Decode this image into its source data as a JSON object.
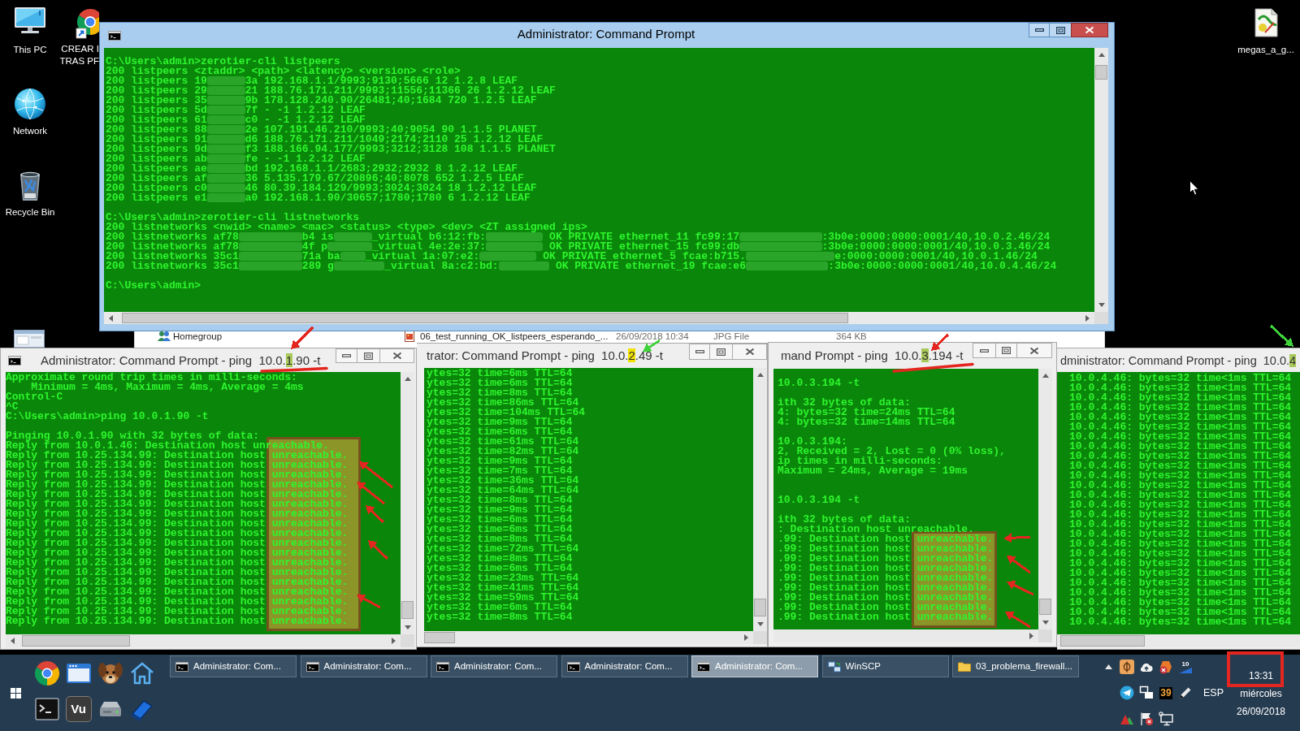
{
  "desktop_icons": [
    {
      "label": [
        "This PC"
      ]
    },
    {
      "label": [
        "CREAR I",
        "TRAS PF"
      ]
    },
    {
      "label": [
        "Network"
      ]
    },
    {
      "label": [
        "Recycle Bin"
      ]
    },
    {
      "label": [
        "megas_a_g..."
      ]
    }
  ],
  "main_console": {
    "title": "Administrator: Command Prompt",
    "active": true,
    "lines": [
      {
        "kind": "text",
        "parts": [
          "C:\\Users\\admin>zerotier-cli listpeers"
        ]
      },
      {
        "kind": "text",
        "parts": [
          "200 listpeers <ztaddr> <path> <latency> <version> <role>"
        ]
      },
      {
        "kind": "text",
        "parts": [
          "200 listpeers 19",
          "3a 192.168.1.1/9993;9130;5666 12 1.2.8 LEAF"
        ]
      },
      {
        "kind": "text",
        "parts": [
          "200 listpeers 29",
          "21 188.76.171.211/9993;11556;11366 26 1.2.12 LEAF"
        ]
      },
      {
        "kind": "text",
        "parts": [
          "200 listpeers 35",
          "9b 178.128.240.90/26481;40;1684 720 1.2.5 LEAF"
        ]
      },
      {
        "kind": "text",
        "parts": [
          "200 listpeers 5d",
          "7f - -1 1.2.12 LEAF"
        ]
      },
      {
        "kind": "text",
        "parts": [
          "200 listpeers 61",
          "c0 - -1 1.2.12 LEAF"
        ]
      },
      {
        "kind": "text",
        "parts": [
          "200 listpeers 88",
          "2e 107.191.46.210/9993;40;9054 90 1.1.5 PLANET"
        ]
      },
      {
        "kind": "text",
        "parts": [
          "200 listpeers 91",
          "d6 188.76.171.211/1049;2174;2110 25 1.2.12 LEAF"
        ]
      },
      {
        "kind": "text",
        "parts": [
          "200 listpeers 9d",
          "f3 188.166.94.177/9993;3212;3128 108 1.1.5 PLANET"
        ]
      },
      {
        "kind": "text",
        "parts": [
          "200 listpeers ab",
          "fe - -1 1.2.12 LEAF"
        ]
      },
      {
        "kind": "text",
        "parts": [
          "200 listpeers ae",
          "bd 192.168.1.1/2683;2932;2932 8 1.2.12 LEAF"
        ]
      },
      {
        "kind": "text",
        "parts": [
          "200 listpeers af",
          "36 5.135.179.67/20896;40;8078 652 1.2.5 LEAF"
        ]
      },
      {
        "kind": "text",
        "parts": [
          "200 listpeers c0",
          "46 80.39.184.129/9993;3024;3024 18 1.2.12 LEAF"
        ]
      },
      {
        "kind": "text",
        "parts": [
          "200 listpeers e1",
          "a0 192.168.1.90/30657;1780;1780 6 1.2.12 LEAF"
        ]
      },
      {
        "kind": "blank"
      },
      {
        "kind": "text",
        "parts": [
          "C:\\Users\\admin>zerotier-cli listnetworks"
        ]
      },
      {
        "kind": "text",
        "parts": [
          "200 listnetworks <nwid> <name> <mac> <status> <type> <dev> <ZT assigned ips>"
        ]
      },
      {
        "kind": "text",
        "parts": [
          "200 listnetworks af78",
          "b4 is",
          "_virtual b6:12:fb:",
          " OK PRIVATE ethernet_11 fc99:17",
          ":3b0e:0000:0000:0001/40,10.0.2.46/24"
        ]
      },
      {
        "kind": "text",
        "parts": [
          "200 listnetworks af78",
          "4f p",
          "_virtual 4e:2e:37:",
          " OK PRIVATE ethernet_15 fc99:db",
          ":3b0e:0000:0000:0001/40,10.0.3.46/24"
        ]
      },
      {
        "kind": "text",
        "parts": [
          "200 listnetworks 35c1",
          "71a ba",
          "_virtual 1a:07:e2:",
          " OK PRIVATE ethernet_5 fcae:b715.",
          "e:0000:0000:0001/40,10.0.1.46/24"
        ]
      },
      {
        "kind": "text",
        "parts": [
          "200 listnetworks 35c1",
          "289 g",
          "_virtual 8a:c2:bd:",
          " OK PRIVATE ethernet_19 fcae:e6",
          ":3b0e:0000:0000:0001/40,10.0.4.46/24"
        ]
      },
      {
        "kind": "blank"
      },
      {
        "kind": "text",
        "parts": [
          "C:\\Users\\admin>"
        ]
      }
    ]
  },
  "explorer_window": {
    "nav_item": "Homegroup",
    "file": {
      "name": "06_test_running_OK_listpeers_esperando_...",
      "date_modified": "26/09/2018 10:34",
      "type": "JPG File",
      "size": "364 KB"
    }
  },
  "ping_windows": [
    {
      "active": false,
      "title": [
        {
          "text": "Administrator: Command Prompt - ping  10.0.",
          "highlighted": false
        },
        {
          "text": "1",
          "highlighted": true,
          "color": "#a9c95a"
        },
        {
          "text": ".90 -t",
          "highlighted": false
        }
      ],
      "lines": [
        {
          "kind": "text",
          "text": "Approximate round trip times in milli-seconds:"
        },
        {
          "kind": "text",
          "text": "    Minimum = 4ms, Maximum = 4ms, Average = 4ms"
        },
        {
          "kind": "text",
          "text": "Control-C"
        },
        {
          "kind": "text",
          "text": "^C"
        },
        {
          "kind": "text",
          "text": "C:\\Users\\admin>ping 10.0.1.90 -t"
        },
        {
          "kind": "blank"
        },
        {
          "kind": "text",
          "text": "Pinging 10.0.1.90 with 32 bytes of data:"
        },
        {
          "kind": "text",
          "text": "Reply from 10.0.1.46: Destination host unreachable."
        },
        {
          "kind": "text",
          "text": "Reply from 10.25.134.99: Destination host unreachable."
        },
        {
          "kind": "text",
          "text": "Reply from 10.25.134.99: Destination host unreachable."
        },
        {
          "kind": "text",
          "text": "Reply from 10.25.134.99: Destination host unreachable."
        },
        {
          "kind": "text",
          "text": "Reply from 10.25.134.99: Destination host unreachable."
        },
        {
          "kind": "text",
          "text": "Reply from 10.25.134.99: Destination host unreachable."
        },
        {
          "kind": "text",
          "text": "Reply from 10.25.134.99: Destination host unreachable."
        },
        {
          "kind": "text",
          "text": "Reply from 10.25.134.99: Destination host unreachable."
        },
        {
          "kind": "text",
          "text": "Reply from 10.25.134.99: Destination host unreachable."
        },
        {
          "kind": "text",
          "text": "Reply from 10.25.134.99: Destination host unreachable."
        },
        {
          "kind": "text",
          "text": "Reply from 10.25.134.99: Destination host unreachable."
        },
        {
          "kind": "text",
          "text": "Reply from 10.25.134.99: Destination host unreachable."
        },
        {
          "kind": "text",
          "text": "Reply from 10.25.134.99: Destination host unreachable."
        },
        {
          "kind": "text",
          "text": "Reply from 10.25.134.99: Destination host unreachable."
        },
        {
          "kind": "text",
          "text": "Reply from 10.25.134.99: Destination host unreachable."
        },
        {
          "kind": "text",
          "text": "Reply from 10.25.134.99: Destination host unreachable."
        },
        {
          "kind": "text",
          "text": "Reply from 10.25.134.99: Destination host unreachable."
        },
        {
          "kind": "text",
          "text": "Reply from 10.25.134.99: Destination host unreachable."
        },
        {
          "kind": "text",
          "text": "Reply from 10.25.134.99: Destination host unreachable."
        }
      ]
    },
    {
      "active": false,
      "title": [
        {
          "text": "trator: Command Prompt - ping  10.0.",
          "highlighted": false
        },
        {
          "text": "2",
          "highlighted": true,
          "color": "#f2e200"
        },
        {
          "text": ".49 -t",
          "highlighted": false
        }
      ],
      "lines": [
        {
          "kind": "text",
          "text": "ytes=32 time=6ms TTL=64"
        },
        {
          "kind": "text",
          "text": "ytes=32 time=6ms TTL=64"
        },
        {
          "kind": "text",
          "text": "ytes=32 time=8ms TTL=64"
        },
        {
          "kind": "text",
          "text": "ytes=32 time=86ms TTL=64"
        },
        {
          "kind": "text",
          "text": "ytes=32 time=104ms TTL=64"
        },
        {
          "kind": "text",
          "text": "ytes=32 time=9ms TTL=64"
        },
        {
          "kind": "text",
          "text": "ytes=32 time=6ms TTL=64"
        },
        {
          "kind": "text",
          "text": "ytes=32 time=61ms TTL=64"
        },
        {
          "kind": "text",
          "text": "ytes=32 time=82ms TTL=64"
        },
        {
          "kind": "text",
          "text": "ytes=32 time=9ms TTL=64"
        },
        {
          "kind": "text",
          "text": "ytes=32 time=7ms TTL=64"
        },
        {
          "kind": "text",
          "text": "ytes=32 time=36ms TTL=64"
        },
        {
          "kind": "text",
          "text": "ytes=32 time=64ms TTL=64"
        },
        {
          "kind": "text",
          "text": "ytes=32 time=8ms TTL=64"
        },
        {
          "kind": "text",
          "text": "ytes=32 time=9ms TTL=64"
        },
        {
          "kind": "text",
          "text": "ytes=32 time=6ms TTL=64"
        },
        {
          "kind": "text",
          "text": "ytes=32 time=6ms TTL=64"
        },
        {
          "kind": "text",
          "text": "ytes=32 time=8ms TTL=64"
        },
        {
          "kind": "text",
          "text": "ytes=32 time=72ms TTL=64"
        },
        {
          "kind": "text",
          "text": "ytes=32 time=8ms TTL=64"
        },
        {
          "kind": "text",
          "text": "ytes=32 time=6ms TTL=64"
        },
        {
          "kind": "text",
          "text": "ytes=32 time=23ms TTL=64"
        },
        {
          "kind": "text",
          "text": "ytes=32 time=41ms TTL=64"
        },
        {
          "kind": "text",
          "text": "ytes=32 time=59ms TTL=64"
        },
        {
          "kind": "text",
          "text": "ytes=32 time=6ms TTL=64"
        },
        {
          "kind": "text",
          "text": "ytes=32 time=8ms TTL=64"
        }
      ]
    },
    {
      "active": false,
      "title": [
        {
          "text": "mand Prompt - ping  10.0.",
          "highlighted": false
        },
        {
          "text": "3",
          "highlighted": true,
          "color": "#a9c95a"
        },
        {
          "text": ".194 -t",
          "highlighted": false
        }
      ],
      "lines": [
        {
          "kind": "blank"
        },
        {
          "kind": "text",
          "text": "10.0.3.194 -t"
        },
        {
          "kind": "blank"
        },
        {
          "kind": "text",
          "text": "ith 32 bytes of data:"
        },
        {
          "kind": "text",
          "text": "4: bytes=32 time=24ms TTL=64"
        },
        {
          "kind": "text",
          "text": "4: bytes=32 time=14ms TTL=64"
        },
        {
          "kind": "blank"
        },
        {
          "kind": "text",
          "text": "10.0.3.194:"
        },
        {
          "kind": "text",
          "text": "2, Received = 2, Lost = 0 (0% loss),"
        },
        {
          "kind": "text",
          "text": "ip times in milli-seconds:"
        },
        {
          "kind": "text",
          "text": "Maximum = 24ms, Average = 19ms"
        },
        {
          "kind": "blank"
        },
        {
          "kind": "blank"
        },
        {
          "kind": "text",
          "text": "10.0.3.194 -t"
        },
        {
          "kind": "blank"
        },
        {
          "kind": "text",
          "text": "ith 32 bytes of data:"
        },
        {
          "kind": "text",
          "text": ": Destination host unreachable."
        },
        {
          "kind": "text",
          "text": ".99: Destination host unreachable."
        },
        {
          "kind": "text",
          "text": ".99: Destination host unreachable."
        },
        {
          "kind": "text",
          "text": ".99: Destination host unreachable."
        },
        {
          "kind": "text",
          "text": ".99: Destination host unreachable."
        },
        {
          "kind": "text",
          "text": ".99: Destination host unreachable."
        },
        {
          "kind": "text",
          "text": ".99: Destination host unreachable."
        },
        {
          "kind": "text",
          "text": ".99: Destination host unreachable."
        },
        {
          "kind": "text",
          "text": ".99: Destination host unreachable."
        },
        {
          "kind": "text",
          "text": ".99: Destination host unreachable."
        }
      ]
    },
    {
      "active": false,
      "title": [
        {
          "text": "dministrator: Command Prompt - ping  10.0.",
          "highlighted": false
        },
        {
          "text": "4",
          "highlighted": true,
          "color": "#a9c95a"
        }
      ],
      "lines": [
        {
          "kind": "text",
          "text": "10.0.4.46: bytes=32 time<1ms TTL=64"
        },
        {
          "kind": "text",
          "text": "10.0.4.46: bytes=32 time<1ms TTL=64"
        },
        {
          "kind": "text",
          "text": "10.0.4.46: bytes=32 time<1ms TTL=64"
        },
        {
          "kind": "text",
          "text": "10.0.4.46: bytes=32 time<1ms TTL=64"
        },
        {
          "kind": "text",
          "text": "10.0.4.46: bytes=32 time<1ms TTL=64"
        },
        {
          "kind": "text",
          "text": "10.0.4.46: bytes=32 time<1ms TTL=64"
        },
        {
          "kind": "text",
          "text": "10.0.4.46: bytes=32 time<1ms TTL=64"
        },
        {
          "kind": "text",
          "text": "10.0.4.46: bytes=32 time<1ms TTL=64"
        },
        {
          "kind": "text",
          "text": "10.0.4.46: bytes=32 time<1ms TTL=64"
        },
        {
          "kind": "text",
          "text": "10.0.4.46: bytes=32 time<1ms TTL=64"
        },
        {
          "kind": "text",
          "text": "10.0.4.46: bytes=32 time<1ms TTL=64"
        },
        {
          "kind": "text",
          "text": "10.0.4.46: bytes=32 time<1ms TTL=64"
        },
        {
          "kind": "text",
          "text": "10.0.4.46: bytes=32 time<1ms TTL=64"
        },
        {
          "kind": "text",
          "text": "10.0.4.46: bytes=32 time<1ms TTL=64"
        },
        {
          "kind": "text",
          "text": "10.0.4.46: bytes=32 time<1ms TTL=64"
        },
        {
          "kind": "text",
          "text": "10.0.4.46: bytes=32 time<1ms TTL=64"
        },
        {
          "kind": "text",
          "text": "10.0.4.46: bytes=32 time<1ms TTL=64"
        },
        {
          "kind": "text",
          "text": "10.0.4.46: bytes=32 time<1ms TTL=64"
        },
        {
          "kind": "text",
          "text": "10.0.4.46: bytes=32 time<1ms TTL=64"
        },
        {
          "kind": "text",
          "text": "10.0.4.46: bytes=32 time<1ms TTL=64"
        },
        {
          "kind": "text",
          "text": "10.0.4.46: bytes=32 time<1ms TTL=64"
        },
        {
          "kind": "text",
          "text": "10.0.4.46: bytes=32 time<1ms TTL=64"
        },
        {
          "kind": "text",
          "text": "10.0.4.46: bytes=32 time<1ms TTL=64"
        },
        {
          "kind": "text",
          "text": "10.0.4.46: bytes=32 time<1ms TTL=64"
        },
        {
          "kind": "text",
          "text": "10.0.4.46: bytes=32 time<1ms TTL=64"
        },
        {
          "kind": "text",
          "text": "10.0.4.46: bytes=32 time<1ms TTL=64"
        }
      ]
    }
  ],
  "annotations": [
    {
      "kind": "arrow",
      "color": "#e3261f"
    },
    {
      "kind": "underline",
      "color": "#e3261f"
    },
    {
      "kind": "box",
      "color": "#76521e"
    },
    {
      "kind": "arrow",
      "color": "#e3261f"
    },
    {
      "kind": "arrow",
      "color": "#e3261f"
    },
    {
      "kind": "arrow",
      "color": "#e3261f"
    },
    {
      "kind": "arrow",
      "color": "#e3261f"
    },
    {
      "kind": "arrow",
      "color": "#e3261f"
    },
    {
      "kind": "arrow",
      "color": "#3fd23a"
    },
    {
      "kind": "arrow",
      "color": "#e3261f"
    },
    {
      "kind": "underline",
      "color": "#e3261f"
    },
    {
      "kind": "box",
      "color": "#76521e"
    },
    {
      "kind": "arrow",
      "color": "#e3261f"
    },
    {
      "kind": "arrow",
      "color": "#e3261f"
    },
    {
      "kind": "arrow",
      "color": "#e3261f"
    },
    {
      "kind": "arrow",
      "color": "#e3261f"
    },
    {
      "kind": "arrow",
      "color": "#3fd23a"
    },
    {
      "kind": "frame",
      "color": "#e3261f"
    }
  ],
  "taskbar": {
    "quick_launch_label": "Vu",
    "buttons": [
      {
        "label": "Administrator: Com...",
        "selected": false
      },
      {
        "label": "Administrator: Com...",
        "selected": false
      },
      {
        "label": "Administrator: Com...",
        "selected": false
      },
      {
        "label": "Administrator: Com...",
        "selected": false
      },
      {
        "label": "Administrator: Com...",
        "selected": true
      },
      {
        "label": "WinSCP",
        "selected": false
      },
      {
        "label": "03_problema_firewall...",
        "selected": false
      }
    ],
    "tray_badges": [
      "10",
      "39"
    ],
    "language": "ESP",
    "clock": {
      "time": "13:31",
      "day": "miércoles",
      "date": "26/09/2018"
    }
  }
}
